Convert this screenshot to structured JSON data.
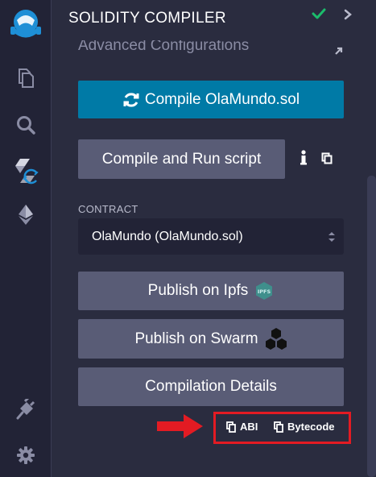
{
  "panel": {
    "title": "SOLIDITY COMPILER",
    "advanced_config": "Advanced Configurations"
  },
  "buttons": {
    "compile": "Compile OlaMundo.sol",
    "compile_run": "Compile and Run script",
    "publish_ipfs": "Publish on Ipfs",
    "publish_swarm": "Publish on Swarm",
    "compilation_details": "Compilation Details"
  },
  "contract": {
    "label": "CONTRACT",
    "selected": "OlaMundo (OlaMundo.sol)"
  },
  "copy": {
    "abi": "ABI",
    "bytecode": "Bytecode"
  },
  "ipfs_badge": "IPFS",
  "sidebar_icons": [
    "remix-logo-icon",
    "file-explorer-icon",
    "search-icon",
    "solidity-compiler-icon",
    "deploy-run-icon",
    "plugin-manager-icon",
    "settings-icon"
  ],
  "colors": {
    "accent": "#007aa6",
    "secondary_button": "#595c76",
    "success": "#1bbc6b",
    "highlight": "#e31b23"
  }
}
